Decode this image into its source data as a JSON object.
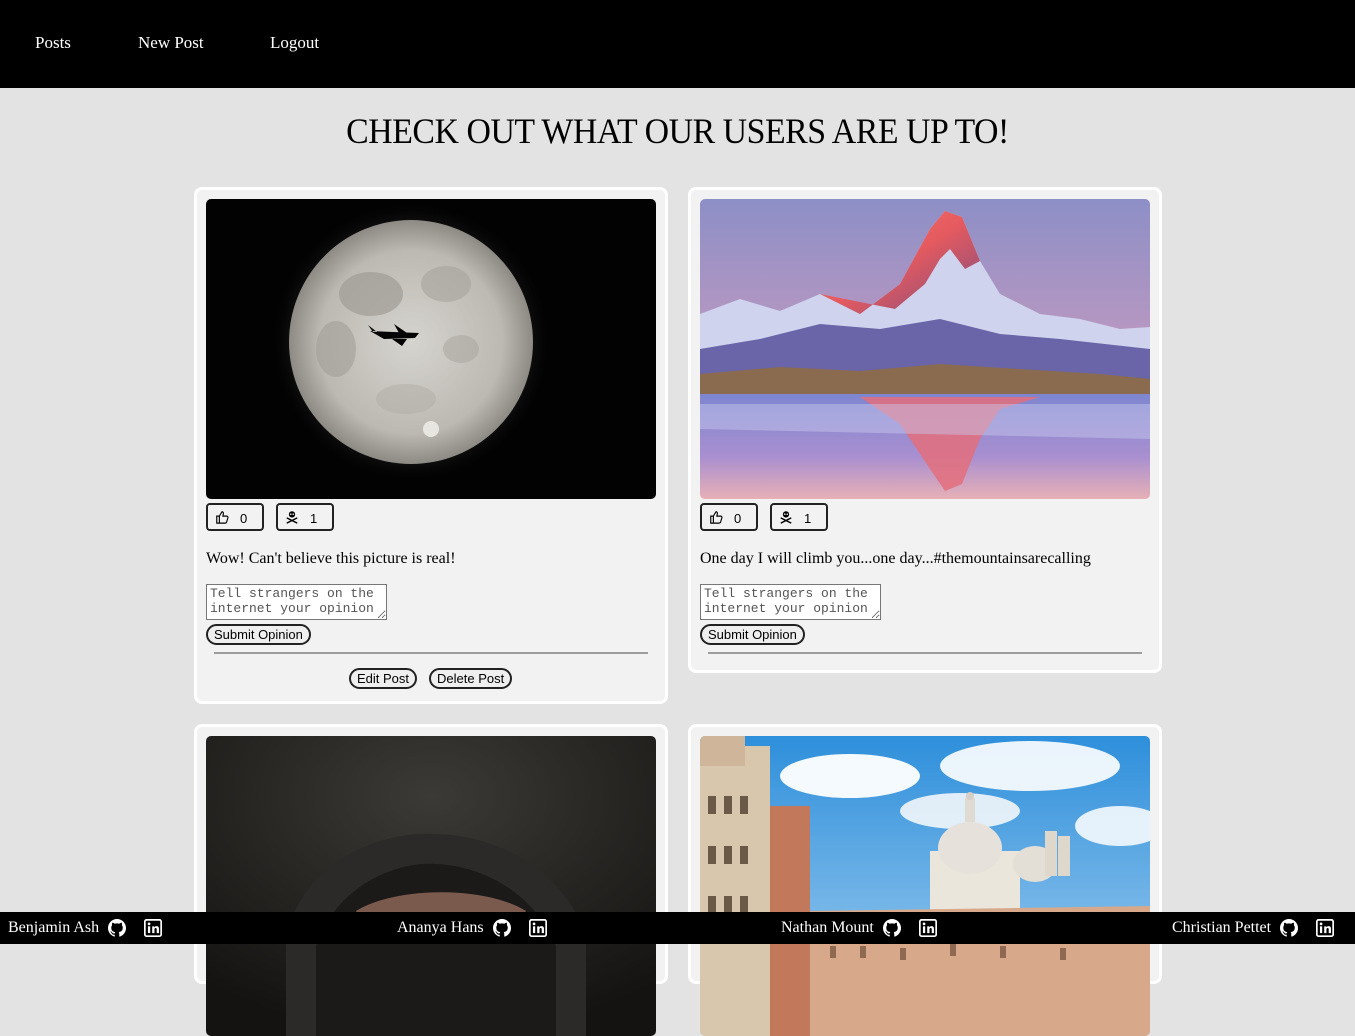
{
  "nav": {
    "links": [
      "Posts",
      "New Post",
      "Logout"
    ]
  },
  "page": {
    "title": "CHECK OUT WHAT OUR USERS ARE UP TO!"
  },
  "posts": [
    {
      "image": "full moon with airplane silhouette",
      "likes": "0",
      "dislikes": "1",
      "caption": "Wow! Can't believe this picture is real!",
      "opinion_placeholder": "Tell strangers on the internet your opinion",
      "submit_label": "Submit Opinion",
      "edit_label": "Edit Post",
      "delete_label": "Delete Post"
    },
    {
      "image": "snowy mountain peak reflected in lake at sunrise",
      "likes": "0",
      "dislikes": "1",
      "caption": "One day I will climb you...one day...#themountainsarecalling",
      "opinion_placeholder": "Tell strangers on the internet your opinion",
      "submit_label": "Submit Opinion"
    },
    {
      "image": "person in dark hood"
    },
    {
      "image": "Venice waterfront with domed basilica"
    }
  ],
  "footer": {
    "credits": [
      {
        "name": "Benjamin Ash"
      },
      {
        "name": "Ananya Hans"
      },
      {
        "name": "Nathan Mount"
      },
      {
        "name": "Christian Pettet"
      }
    ],
    "icons": [
      "github-icon",
      "linkedin-icon"
    ]
  }
}
